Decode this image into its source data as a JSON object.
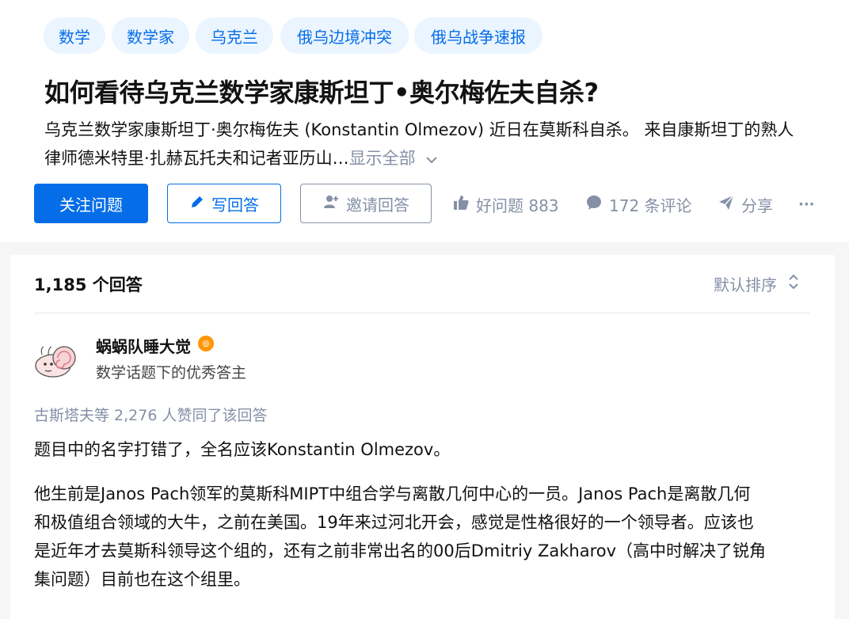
{
  "topics": [
    "数学",
    "数学家",
    "乌克兰",
    "俄乌边境冲突",
    "俄乌战争速报"
  ],
  "question": {
    "title": "如何看待乌克兰数学家康斯坦丁•奥尔梅佐夫自杀?",
    "desc_line1": "乌克兰数学家康斯坦丁·奥尔梅佐夫 (Konstantin Olmezov) 近日在莫斯科自杀。 来自康斯坦丁的熟人",
    "desc_line2": "律师德米特里·扎赫瓦托夫和记者亚历山…",
    "show_all": "显示全部"
  },
  "actions": {
    "follow": "关注问题",
    "write_answer": "写回答",
    "invite": "邀请回答",
    "good_question": "好问题 883",
    "comments": "172 条评论",
    "share": "分享",
    "more": "···"
  },
  "answers_header": {
    "count": "1,185 个回答",
    "sort": "默认排序"
  },
  "answer": {
    "author": "蜗蜗队睡大觉",
    "bio": "数学话题下的优秀答主",
    "votes": "古斯塔夫等 2,276 人赞同了该回答",
    "p1": "题目中的名字打错了，全名应该Konstantin Olmezov。",
    "p2_lines": [
      "他生前是Janos Pach领军的莫斯科MIPT中组合学与离散几何中心的一员。Janos Pach是离散几何",
      "和极值组合领域的大牛，之前在美国。19年来过河北开会，感觉是性格很好的一个领导者。应该也",
      "是近年才去莫斯科领导这个组的，还有之前非常出名的00后Dmitriy Zakharov（高中时解决了锐角",
      "集问题）目前也在这个组里。"
    ]
  },
  "colors": {
    "brand": "#056de8",
    "topic_bg": "#ebf5ff",
    "muted": "#8590a6",
    "badge": "#ff9607"
  }
}
